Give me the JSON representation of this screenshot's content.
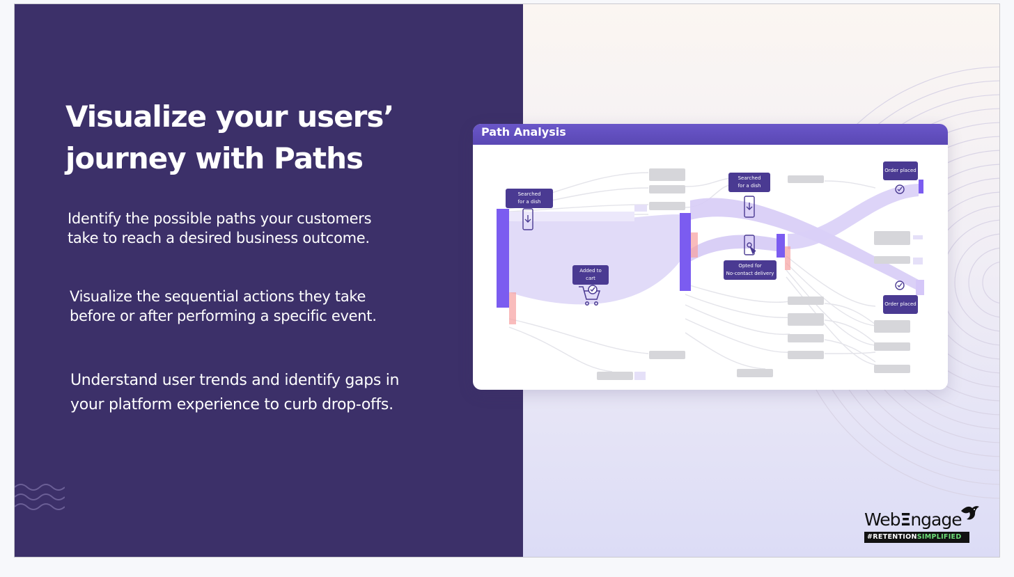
{
  "headline": {
    "line1": "Visualize your users’",
    "line2": "journey with Paths"
  },
  "bullets": [
    {
      "line1": "Identify the possible paths your customers",
      "line2": "take to reach a desired business outcome."
    },
    {
      "line1": "Visualize the sequential actions they take",
      "line2": "before or after performing a specific event."
    },
    {
      "line1": "Understand user trends and identify gaps in",
      "line2": "your platform experience to curb drop-offs."
    }
  ],
  "card": {
    "title": "Path Analysis",
    "nodes": {
      "searched_1": {
        "line1": "Searched",
        "line2": "for a dish"
      },
      "searched_2": {
        "line1": "Searched",
        "line2": "for a dish"
      },
      "added_to_cart": {
        "line1": "Added to",
        "line2": "cart"
      },
      "opted_delivery": {
        "line1": "Opted for",
        "line2": "No-contact delivery"
      },
      "order_placed_top": "Order placed",
      "order_placed_bottom": "Order placed"
    },
    "icons": [
      "phone-download-icon",
      "cart-check-icon",
      "phone-tap-icon",
      "check-circle-icon"
    ]
  },
  "logo": {
    "word_part1": "Web",
    "word_part2": "ngage",
    "tag_part1": "#RETENTION",
    "tag_part2": "SIMPLIFIED"
  },
  "colors": {
    "left_panel": "#3c3069",
    "accent_purple": "#6a56c9",
    "node_bar": "#7b5cf0",
    "node_label": "#4a3a92",
    "flow": "#cfc6f2",
    "placeholder": "#d6d6da",
    "logo_tag_accent": "#6fe07a"
  }
}
